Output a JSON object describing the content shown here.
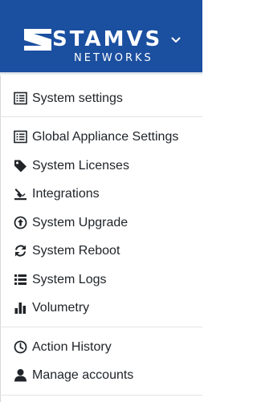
{
  "brand": {
    "name": "STAMVS",
    "subtitle": "NETWORKS",
    "header_color": "#1b4fa0",
    "icon": "stamus-logo-mark",
    "dropdown_icon": "chevron-down-icon"
  },
  "menu": {
    "sections": [
      {
        "items": [
          {
            "label": "System settings",
            "icon": "list-alt-icon"
          }
        ]
      },
      {
        "items": [
          {
            "label": "Global Appliance Settings",
            "icon": "list-alt-icon"
          },
          {
            "label": "System Licenses",
            "icon": "tag-icon"
          },
          {
            "label": "Integrations",
            "icon": "plug-icon"
          },
          {
            "label": "System Upgrade",
            "icon": "arrow-circle-up-icon"
          },
          {
            "label": "System Reboot",
            "icon": "sync-icon"
          },
          {
            "label": "System Logs",
            "icon": "list-icon"
          },
          {
            "label": "Volumetry",
            "icon": "bar-chart-icon"
          }
        ]
      },
      {
        "items": [
          {
            "label": "Action History",
            "icon": "clock-icon"
          },
          {
            "label": "Manage accounts",
            "icon": "user-icon"
          }
        ]
      }
    ]
  }
}
